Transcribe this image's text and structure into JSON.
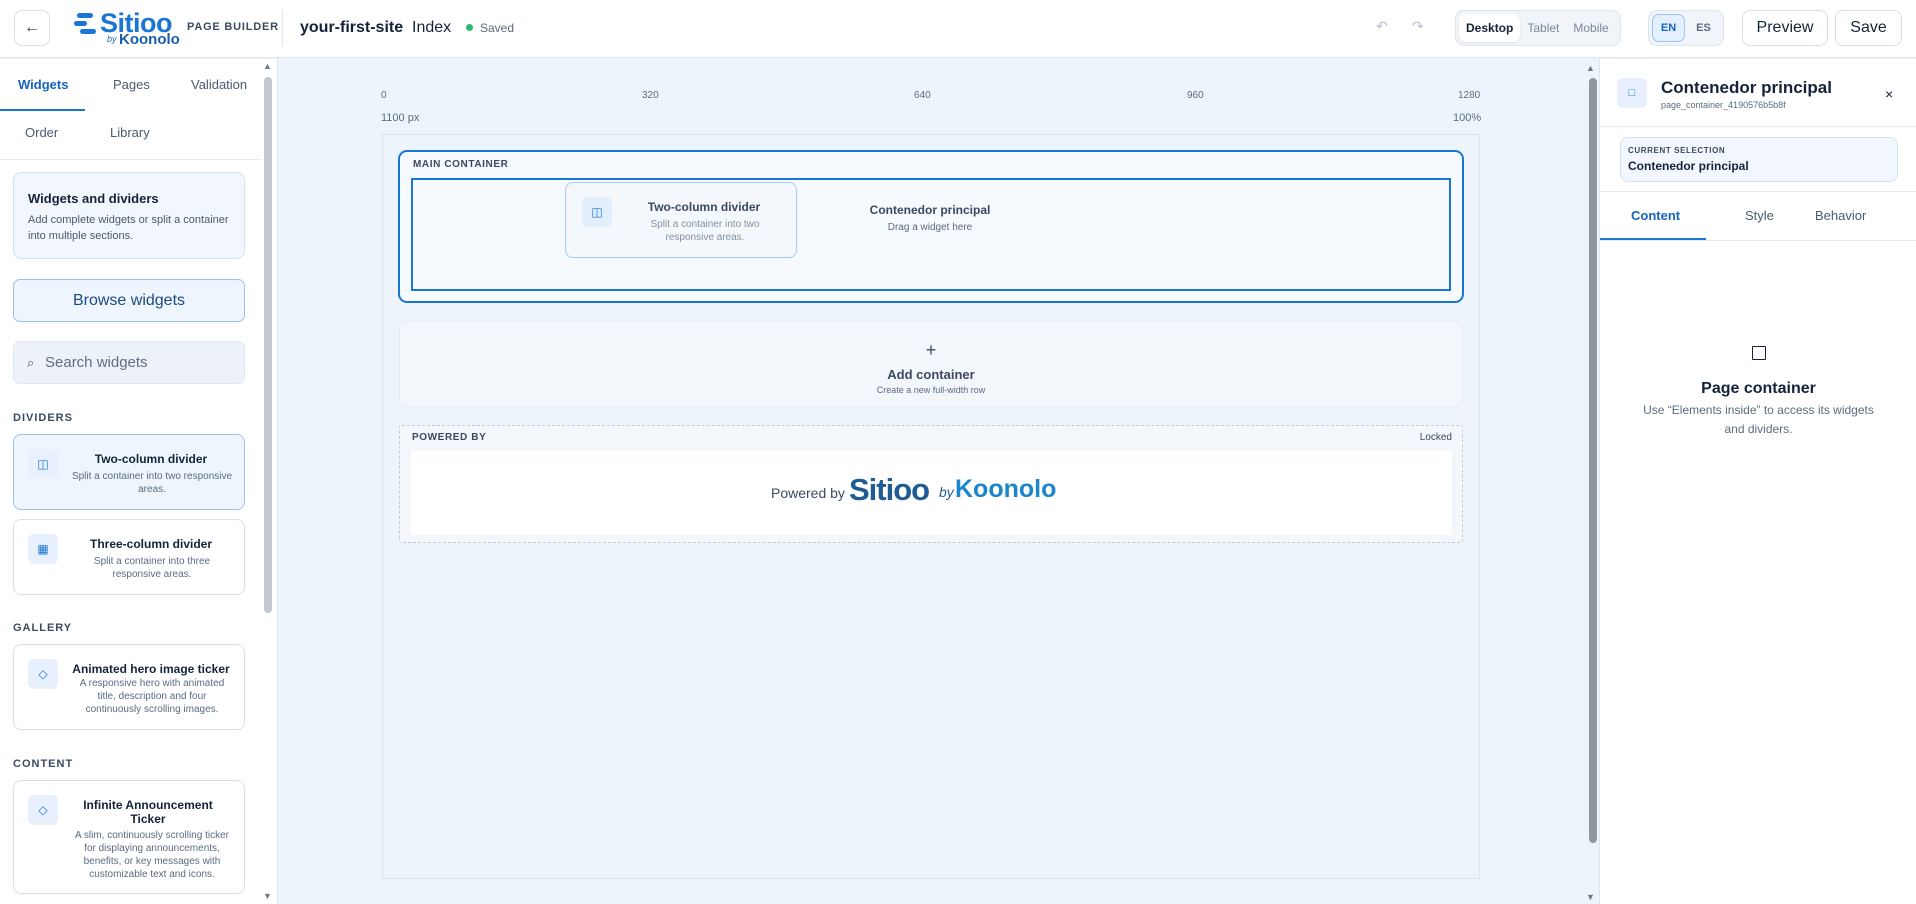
{
  "topbar": {
    "back_icon": "←",
    "brand": "Sitioo",
    "brand_by": "by",
    "brand_sub": "Koonolo",
    "page_builder": "PAGE BUILDER",
    "site_name": "your-first-site",
    "page_name": "Index",
    "status": "Saved",
    "undo_icon": "↶",
    "redo_icon": "↷",
    "devices": [
      "Desktop",
      "Tablet",
      "Mobile"
    ],
    "active_device": "Desktop",
    "languages": [
      "EN",
      "ES"
    ],
    "active_language": "EN",
    "preview": "Preview",
    "save": "Save"
  },
  "left": {
    "tabs": [
      "Widgets",
      "Pages",
      "Validation",
      "Order",
      "Library"
    ],
    "active_tab": "Widgets",
    "info": {
      "title": "Widgets and dividers",
      "text": "Add complete widgets or split a container into multiple sections."
    },
    "browse": "Browse widgets",
    "search_placeholder": "Search widgets",
    "sections": [
      {
        "title": "DIVIDERS",
        "items": [
          {
            "title": "Two-column divider",
            "desc": "Split a container into two responsive areas.",
            "icon": "columns-icon"
          },
          {
            "title": "Three-column divider",
            "desc": "Split a container into three responsive areas.",
            "icon": "three-columns-icon"
          }
        ]
      },
      {
        "title": "GALLERY",
        "items": [
          {
            "title": "Animated hero image ticker",
            "desc": "A responsive hero with animated title, description and four continuously scrolling images.",
            "icon": "diamond-icon"
          }
        ]
      },
      {
        "title": "CONTENT",
        "items": [
          {
            "title": "Infinite Announcement Ticker",
            "desc": "A slim, continuously scrolling ticker for displaying announcements, benefits, or key messages with customizable text and icons.",
            "icon": "diamond-icon"
          }
        ]
      }
    ]
  },
  "canvas": {
    "ruler": [
      "0",
      "320",
      "640",
      "960",
      "1280"
    ],
    "width_label": "1100 px",
    "zoom": "100%",
    "main_container": {
      "label": "MAIN CONTAINER",
      "drop_title": "Contenedor principal",
      "drop_hint": "Drag a widget here"
    },
    "dragging": {
      "title": "Two-column divider",
      "desc": "Split a container into two responsive areas."
    },
    "add_container": {
      "plus": "+",
      "title": "Add container",
      "desc": "Create a new full-width row"
    },
    "powered": {
      "label": "POWERED BY",
      "locked": "Locked",
      "text": "Powered by",
      "brand": "Sitioo",
      "brand_by": "by",
      "brand_sub": "Koonolo"
    }
  },
  "right": {
    "title": "Contenedor principal",
    "subtitle": "page_container_4190576b5b8f",
    "close": "×",
    "current_selection_label": "CURRENT SELECTION",
    "current_selection_value": "Contenedor principal",
    "tabs": [
      "Content",
      "Style",
      "Behavior"
    ],
    "active_tab": "Content",
    "empty_title": "Page container",
    "empty_desc": "Use “Elements inside” to access its widgets and dividers."
  },
  "colors": {
    "accent": "#1976d2",
    "status_saved": "#2eb872",
    "canvas_bg": "#eef4fb"
  }
}
